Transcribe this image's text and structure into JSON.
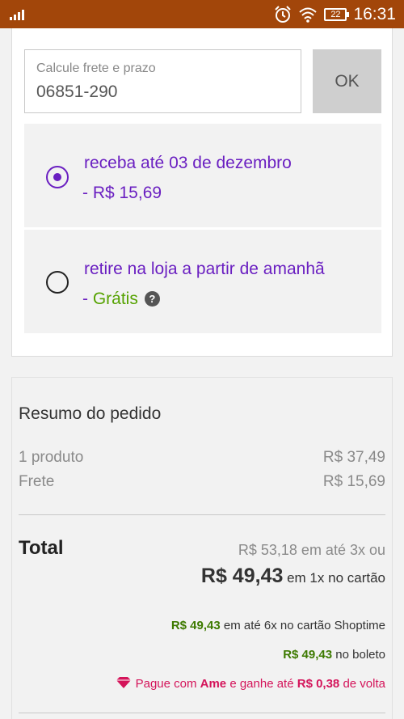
{
  "status_bar": {
    "time": "16:31",
    "battery": "22",
    "icons": [
      "signal-icon",
      "alarm-icon",
      "wifi-icon",
      "battery-icon"
    ],
    "color": "#a2460a"
  },
  "shipping": {
    "cep_label": "Calcule frete e prazo",
    "cep_value": "06851-290",
    "ok_label": "OK",
    "options": [
      {
        "title": "receba até 03 de dezembro",
        "price": "- R$ 15,69",
        "selected": true
      },
      {
        "title": "retire na loja a partir de amanhã",
        "price_prefix": "- ",
        "price": "Grátis",
        "help": "?",
        "selected": false
      }
    ]
  },
  "summary": {
    "title": "Resumo do pedido",
    "rows": [
      {
        "label": "1 produto",
        "value": "R$ 37,49"
      },
      {
        "label": "Frete",
        "value": "R$ 15,69"
      }
    ],
    "total_label": "Total",
    "installment_text": "R$ 53,18 em até 3x ou",
    "main_price": "R$ 49,43",
    "main_suffix": " em 1x no cartão",
    "shoptime_amount": "R$ 49,43",
    "shoptime_suffix": " em até 6x no cartão Shoptime",
    "boleto_amount": "R$ 49,43",
    "boleto_suffix": " no boleto",
    "ame_prefix": "Pague com ",
    "ame_brand": "Ame",
    "ame_middle": " e ganhe até ",
    "ame_amount": "R$ 0,38",
    "ame_suffix": " de volta"
  },
  "colors": {
    "purple": "#6a1fc1",
    "green": "#55a200",
    "dark_green": "#3d7a00",
    "ame_pink": "#d4145a"
  }
}
